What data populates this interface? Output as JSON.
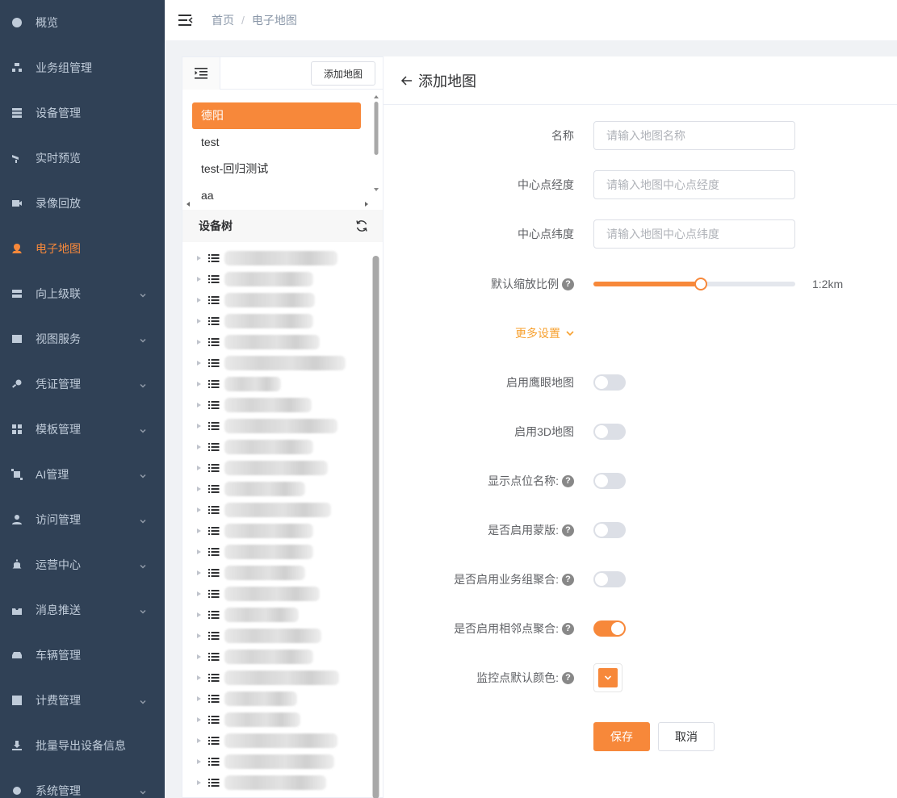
{
  "sidebar": {
    "items": [
      {
        "label": "概览",
        "icon": "dashboard-icon"
      },
      {
        "label": "业务组管理",
        "icon": "org-icon"
      },
      {
        "label": "设备管理",
        "icon": "server-icon"
      },
      {
        "label": "实时预览",
        "icon": "camera-icon"
      },
      {
        "label": "录像回放",
        "icon": "video-icon"
      },
      {
        "label": "电子地图",
        "icon": "map-pin-icon",
        "active": true
      },
      {
        "label": "向上级联",
        "icon": "cascade-icon",
        "expandable": true
      },
      {
        "label": "视图服务",
        "icon": "image-icon",
        "expandable": true
      },
      {
        "label": "凭证管理",
        "icon": "key-icon",
        "expandable": true
      },
      {
        "label": "模板管理",
        "icon": "grid-icon",
        "expandable": true
      },
      {
        "label": "AI管理",
        "icon": "ai-icon",
        "expandable": true
      },
      {
        "label": "访问管理",
        "icon": "user-icon",
        "expandable": true
      },
      {
        "label": "运营中心",
        "icon": "bell-icon",
        "expandable": true
      },
      {
        "label": "消息推送",
        "icon": "inbox-icon",
        "expandable": true
      },
      {
        "label": "车辆管理",
        "icon": "car-icon"
      },
      {
        "label": "计费管理",
        "icon": "yen-icon",
        "expandable": true
      },
      {
        "label": "批量导出设备信息",
        "icon": "download-icon"
      },
      {
        "label": "系统管理",
        "icon": "gear-icon",
        "expandable": true
      }
    ]
  },
  "breadcrumb": {
    "home": "首页",
    "separator": "/",
    "current": "电子地图"
  },
  "left_panel": {
    "add_map_label": "添加地图",
    "maps": [
      "德阳",
      "test",
      "test-回归测试",
      "aa"
    ],
    "selected_index": 0,
    "tree_title": "设备树",
    "tree_row_count": 26
  },
  "form": {
    "title": "添加地图",
    "name_label": "名称",
    "name_placeholder": "请输入地图名称",
    "lng_label": "中心点经度",
    "lng_placeholder": "请输入地图中心点经度",
    "lat_label": "中心点纬度",
    "lat_placeholder": "请输入地图中心点纬度",
    "zoom_label": "默认缩放比例",
    "zoom_value_text": "1:2km",
    "zoom_fraction": 0.53,
    "more_settings": "更多设置",
    "eagle_label": "启用鹰眼地图",
    "eagle_on": false,
    "map3d_label": "启用3D地图",
    "map3d_on": false,
    "show_name_label": "显示点位名称:",
    "show_name_on": false,
    "mask_label": "是否启用蒙版:",
    "mask_on": false,
    "group_cluster_label": "是否启用业务组聚合:",
    "group_cluster_on": false,
    "neighbor_cluster_label": "是否启用相邻点聚合:",
    "neighbor_cluster_on": true,
    "color_label": "监控点默认颜色:",
    "default_color": "#f7883a",
    "save_label": "保存",
    "cancel_label": "取消"
  },
  "colors": {
    "accent": "#f7883a",
    "sidebar_bg": "#304156",
    "link": "#f7a02e"
  }
}
